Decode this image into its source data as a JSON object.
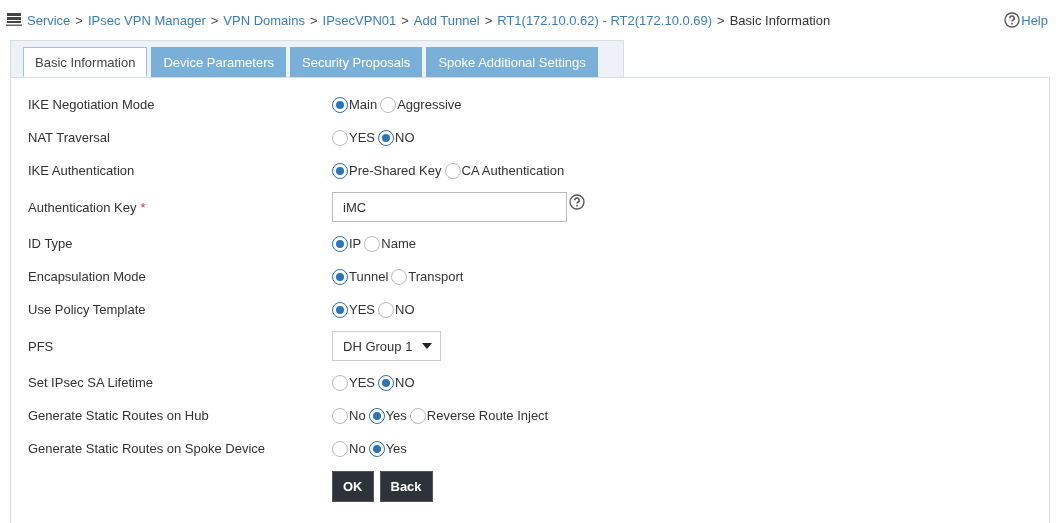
{
  "breadcrumb": [
    {
      "label": "Service",
      "current": false
    },
    {
      "label": "IPsec VPN Manager",
      "current": false
    },
    {
      "label": "VPN Domains",
      "current": false
    },
    {
      "label": "IPsecVPN01",
      "current": false
    },
    {
      "label": "Add Tunnel",
      "current": false
    },
    {
      "label": "RT1(172.10.0.62) - RT2(172.10.0.69)",
      "current": false
    },
    {
      "label": "Basic Information",
      "current": true
    }
  ],
  "breadcrumb_separator": ">",
  "help": {
    "label": "Help"
  },
  "tabs": [
    {
      "label": "Basic Information",
      "selected": true
    },
    {
      "label": "Device Parameters",
      "selected": false
    },
    {
      "label": "Security Proposals",
      "selected": false
    },
    {
      "label": "Spoke Additional Settings",
      "selected": false
    }
  ],
  "fields": [
    {
      "label": "IKE Negotiation Mode",
      "kind": "radio",
      "options": [
        {
          "label": "Main",
          "selected": true
        },
        {
          "label": "Aggressive",
          "selected": false
        }
      ]
    },
    {
      "label": "NAT Traversal",
      "kind": "radio",
      "options": [
        {
          "label": "YES",
          "selected": false
        },
        {
          "label": "NO",
          "selected": true
        }
      ]
    },
    {
      "label": "IKE Authentication",
      "kind": "radio",
      "options": [
        {
          "label": "Pre-Shared Key",
          "selected": true
        },
        {
          "label": "CA Authentication",
          "selected": false
        }
      ]
    },
    {
      "label": "Authentication Key",
      "kind": "text",
      "required": true,
      "required_mark": "*",
      "value": "iMC",
      "help_icon": true
    },
    {
      "label": "ID Type",
      "kind": "radio",
      "options": [
        {
          "label": "IP",
          "selected": true
        },
        {
          "label": "Name",
          "selected": false
        }
      ]
    },
    {
      "label": "Encapsulation Mode",
      "kind": "radio",
      "options": [
        {
          "label": "Tunnel",
          "selected": true
        },
        {
          "label": "Transport",
          "selected": false
        }
      ]
    },
    {
      "label": "Use Policy Template",
      "kind": "radio",
      "options": [
        {
          "label": "YES",
          "selected": true
        },
        {
          "label": "NO",
          "selected": false
        }
      ]
    },
    {
      "label": "PFS",
      "kind": "select",
      "value": "DH Group 1"
    },
    {
      "label": "Set IPsec SA Lifetime",
      "kind": "radio",
      "options": [
        {
          "label": "YES",
          "selected": false
        },
        {
          "label": "NO",
          "selected": true
        }
      ]
    },
    {
      "label": "Generate Static Routes on Hub",
      "kind": "radio",
      "options": [
        {
          "label": "No",
          "selected": false
        },
        {
          "label": "Yes",
          "selected": true
        },
        {
          "label": "Reverse Route Inject",
          "selected": false
        }
      ]
    },
    {
      "label": "Generate Static Routes on Spoke Device",
      "kind": "radio",
      "options": [
        {
          "label": "No",
          "selected": false
        },
        {
          "label": "Yes",
          "selected": true
        }
      ]
    }
  ],
  "buttons": [
    {
      "label": "OK"
    },
    {
      "label": "Back"
    }
  ]
}
